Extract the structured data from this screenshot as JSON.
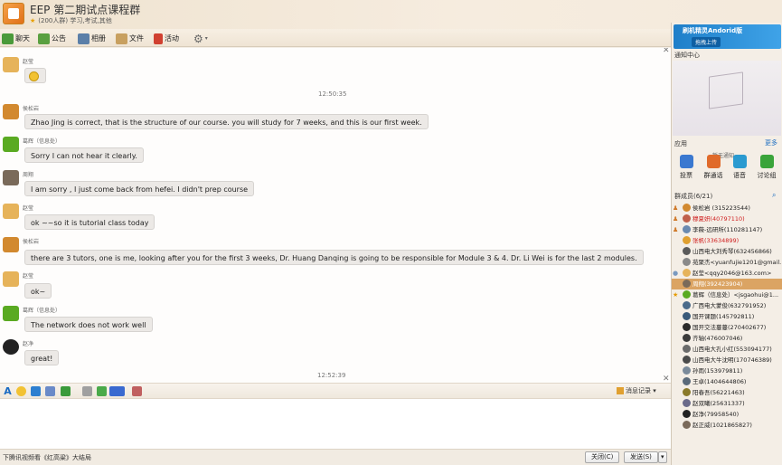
{
  "window": {
    "title": "EEP 第二期试点课程群",
    "subtitle": "(200人群) 学习,考试,其他"
  },
  "toolbar": {
    "items": [
      {
        "label": "聊天",
        "icon": "chat-icon",
        "color": "#4a9a3a"
      },
      {
        "label": "公告",
        "icon": "announcement-icon",
        "color": "#5aa040"
      },
      {
        "label": "相册",
        "icon": "album-icon",
        "color": "#5b7fa8"
      },
      {
        "label": "文件",
        "icon": "folder-icon",
        "color": "#c8a060"
      },
      {
        "label": "活动",
        "icon": "flag-icon",
        "color": "#d04030"
      }
    ]
  },
  "chat": {
    "messages": [
      {
        "sender": "赵莹",
        "text": "",
        "emoji": true,
        "avatar_color": "#e6b35a"
      },
      {
        "time": "12:50:35"
      },
      {
        "sender": "侯松岩",
        "text": "Zhao Jing is correct, that is the structure of our course. you will study for 7 weeks, and this is our first week.",
        "avatar_color": "#d2892f"
      },
      {
        "sender": "葛辉（信息处）",
        "text": "Sorry  I can not hear it clearly.",
        "avatar_color": "#5aaa22"
      },
      {
        "sender": "周翔",
        "text": "I am sorry , I just come back from hefei. I didn't prep course",
        "avatar_color": "#7a6a5a"
      },
      {
        "sender": "赵莹",
        "text": "ok ~~so it is tutorial class today",
        "avatar_color": "#e6b35a"
      },
      {
        "sender": "侯松岩",
        "text": "there are 3 tutors, one is me, looking after you for the first 3 weeks, Dr. Huang Danqing is going to be responsible for Module 3 & 4. Dr. Li Wei is for the last 2 modules.",
        "avatar_color": "#d2892f"
      },
      {
        "sender": "赵莹",
        "text": "ok~",
        "avatar_color": "#e6b35a"
      },
      {
        "sender": "葛辉（信息处）",
        "text": "The network does not work well",
        "avatar_color": "#5aaa22"
      },
      {
        "sender": "赵净",
        "text": "great!",
        "avatar_color": "#222222"
      },
      {
        "time": "12:52:39"
      }
    ]
  },
  "input_toolbar": {
    "history_label": "消息记录"
  },
  "bottom": {
    "news": "下腾讯视频看《红高粱》大结局",
    "close_label": "关闭(C)",
    "send_label": "发送(S)"
  },
  "right": {
    "ad": {
      "title": "刷机精灵Andorid版",
      "button": "拖拽上传"
    },
    "notice_title": "通知中心",
    "notice_empty": "暂无通知",
    "apps_title": "应用",
    "apps_more": "更多",
    "apps": [
      {
        "label": "投票",
        "color": "#3a78d0"
      },
      {
        "label": "群通话",
        "color": "#e06a2a"
      },
      {
        "label": "语音",
        "color": "#2a9ad0"
      },
      {
        "label": "讨论组",
        "color": "#3aa43a"
      }
    ],
    "members_title": "群成员(6/21)",
    "members": [
      {
        "name": "侯松岩 (315223544)",
        "color": "#222222",
        "badge": "person",
        "av": "#d2892f"
      },
      {
        "name": "穆夏妍(40797110)",
        "color": "#d02020",
        "badge": "person",
        "av": "#c0604a"
      },
      {
        "name": "李薇-远研所(110281147)",
        "color": "#222222",
        "badge": "person",
        "av": "#6a8ab0"
      },
      {
        "name": "张帆(33634899)",
        "color": "#d02020",
        "badge": "",
        "av": "#e0a030"
      },
      {
        "name": "山西电大刘秀琴(632456866)",
        "color": "#222222",
        "badge": "",
        "av": "#5a5a5a"
      },
      {
        "name": "苑聚杰<yuanfujie1201@gmail...",
        "color": "#222222",
        "badge": "",
        "av": "#8a8a8a"
      },
      {
        "name": "赵莹<qqy2046@163.com>",
        "color": "#222222",
        "badge": "chat",
        "av": "#e6b35a"
      },
      {
        "name": "周翔(392423904)",
        "color": "#ffffff",
        "badge": "",
        "av": "#7a6a5a",
        "selected": true
      },
      {
        "name": "葛辉（信息处）<jsgaohui@1...",
        "color": "#222222",
        "badge": "star",
        "av": "#5aaa22"
      },
      {
        "name": "广西电大蒙俊(632791952)",
        "color": "#222222",
        "badge": "",
        "av": "#4a6a8a"
      },
      {
        "name": "国开课题(145792811)",
        "color": "#222222",
        "badge": "",
        "av": "#3a5a7a"
      },
      {
        "name": "国开交法蔓蔓(270402677)",
        "color": "#222222",
        "badge": "",
        "av": "#2a2a2a"
      },
      {
        "name": "齐轴(476007046)",
        "color": "#222222",
        "badge": "",
        "av": "#3a3a3a"
      },
      {
        "name": "山西电大孔小红(553094177)",
        "color": "#222222",
        "badge": "",
        "av": "#6a6a6a"
      },
      {
        "name": "山西电大牛沈明(170746389)",
        "color": "#222222",
        "badge": "",
        "av": "#4a4a4a"
      },
      {
        "name": "孙雨(153979811)",
        "color": "#222222",
        "badge": "",
        "av": "#7a8a9a"
      },
      {
        "name": "王卓(1404644806)",
        "color": "#222222",
        "badge": "",
        "av": "#5a6a7a"
      },
      {
        "name": "阳春吾(56221463)",
        "color": "#222222",
        "badge": "",
        "av": "#8a7a2a"
      },
      {
        "name": "赵双曦(25631337)",
        "color": "#222222",
        "badge": "",
        "av": "#6a6a8a"
      },
      {
        "name": "赵净(79958540)",
        "color": "#222222",
        "badge": "",
        "av": "#222222"
      },
      {
        "name": "赵正威(1021865827)",
        "color": "#222222",
        "badge": "",
        "av": "#7a6a5a"
      }
    ]
  }
}
